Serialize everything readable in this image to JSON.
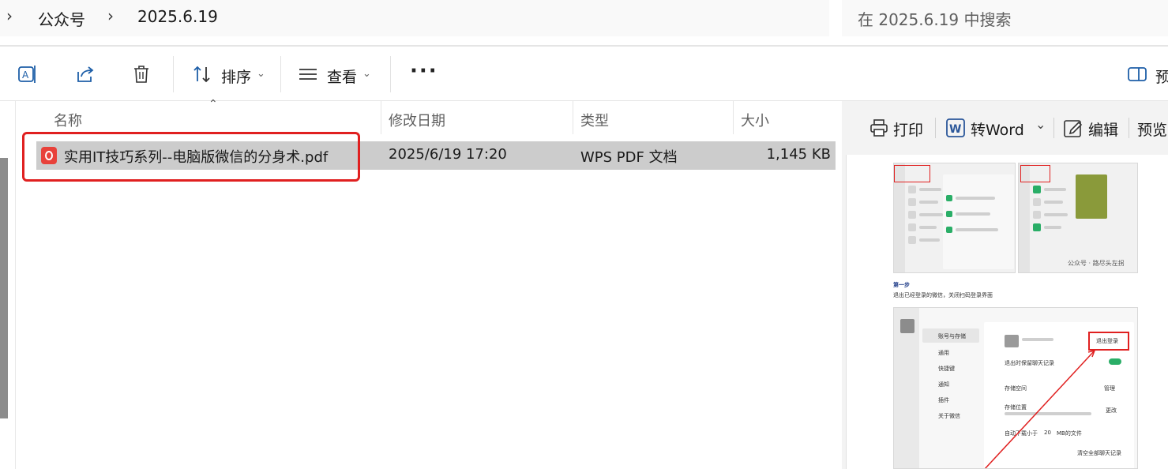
{
  "address": {
    "breadcrumbs": [
      "公众号",
      "2025.6.19"
    ],
    "search_placeholder": "在 2025.6.19 中搜索"
  },
  "toolbar": {
    "sort_label": "排序",
    "view_label": "查看",
    "more_label": "···",
    "preview_label": "预"
  },
  "columns": {
    "name": "名称",
    "modified": "修改日期",
    "type": "类型",
    "size": "大小"
  },
  "files": [
    {
      "name": "实用IT技巧系列--电脑版微信的分身术.pdf",
      "modified": "2025/6/19 17:20",
      "type": "WPS PDF 文档",
      "size": "1,145 KB"
    }
  ],
  "preview": {
    "print": "打印",
    "to_word": "转Word",
    "edit": "编辑",
    "preview": "预览",
    "doc": {
      "step_title": "第一步",
      "step_desc": "退出已经登录的微信，关闭扫码登录界面",
      "watermark": "公众号 · 路尽头左拐",
      "settings_items": [
        "账号与存储",
        "通用",
        "快捷键",
        "通知",
        "插件",
        "关于微信"
      ],
      "logout_button": "退出登录",
      "keep_history": "退出时保留聊天记录",
      "storage_space": "存储空间",
      "manage": "管理",
      "storage_location": "存储位置",
      "change": "更改",
      "auto_download": "自动下载小于",
      "auto_download_value": "20",
      "auto_download_unit": "MB的文件",
      "clear_history": "清空全部聊天记录"
    }
  },
  "colors": {
    "highlight": "#e02020",
    "selected_row": "#cccccc",
    "pdf_icon": "#e8413a",
    "word_icon": "#2b579a"
  },
  "icons": [
    "chevron-right-icon",
    "rename-icon",
    "share-icon",
    "delete-icon",
    "sort-icon",
    "view-icon",
    "more-icon",
    "preview-pane-icon",
    "pdf-file-icon",
    "print-icon",
    "word-icon",
    "edit-icon"
  ]
}
